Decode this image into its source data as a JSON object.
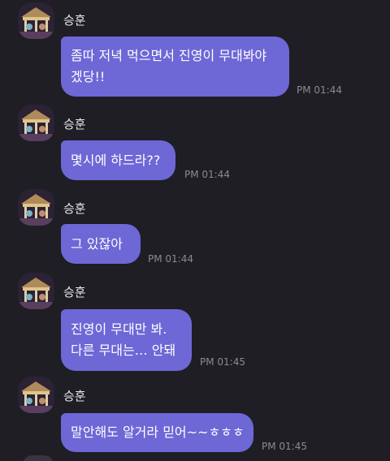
{
  "messages": [
    {
      "sender": "승훈",
      "lines": [
        "좀따 저녁 먹으면서 진영이 무대봐야",
        "겠당!!"
      ],
      "time": "PM 01:44"
    },
    {
      "sender": "승훈",
      "lines": [
        "몇시에 하드라??"
      ],
      "time": "PM 01:44"
    },
    {
      "sender": "승훈",
      "lines": [
        "그 있잖아"
      ],
      "time": "PM 01:44"
    },
    {
      "sender": "승훈",
      "lines": [
        "진영이 무대만 봐.",
        "다른 무대는… 안돼"
      ],
      "time": "PM 01:45"
    },
    {
      "sender": "승훈",
      "lines": [
        "말안해도 알거라 믿어~~ㅎㅎㅎ"
      ],
      "time": "PM 01:45"
    }
  ],
  "colors": {
    "background": "#1e1e24",
    "bubble": "#6e67d6",
    "timestamp": "#8a8a92",
    "sender": "#e4e4ea"
  },
  "icons": {
    "avatar": "carousel-photo-avatar"
  }
}
